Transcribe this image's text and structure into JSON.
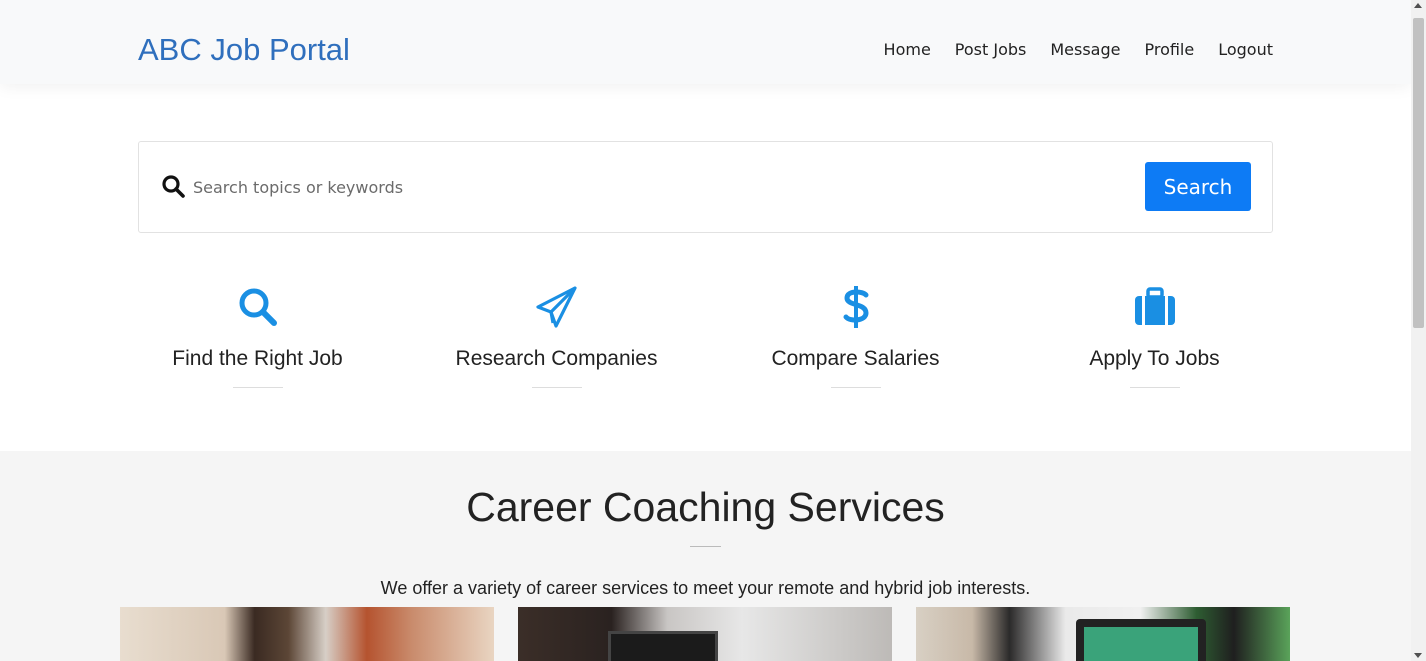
{
  "header": {
    "brand": "ABC Job Portal",
    "nav": [
      "Home",
      "Post Jobs",
      "Message",
      "Profile",
      "Logout"
    ]
  },
  "search": {
    "placeholder": "Search topics or keywords",
    "button_label": "Search",
    "icon": "search-icon"
  },
  "features": [
    {
      "label": "Find the Right Job",
      "icon": "search-icon"
    },
    {
      "label": "Research Companies",
      "icon": "paper-plane-icon"
    },
    {
      "label": "Compare Salaries",
      "icon": "dollar-icon"
    },
    {
      "label": "Apply To Jobs",
      "icon": "briefcase-icon"
    }
  ],
  "services": {
    "title": "Career Coaching Services",
    "subtitle": "We offer a variety of career services to meet your remote and hybrid job interests."
  },
  "colors": {
    "brand": "#2f6fbd",
    "accent": "#0d7bf5",
    "icon": "#1a8fe3"
  }
}
